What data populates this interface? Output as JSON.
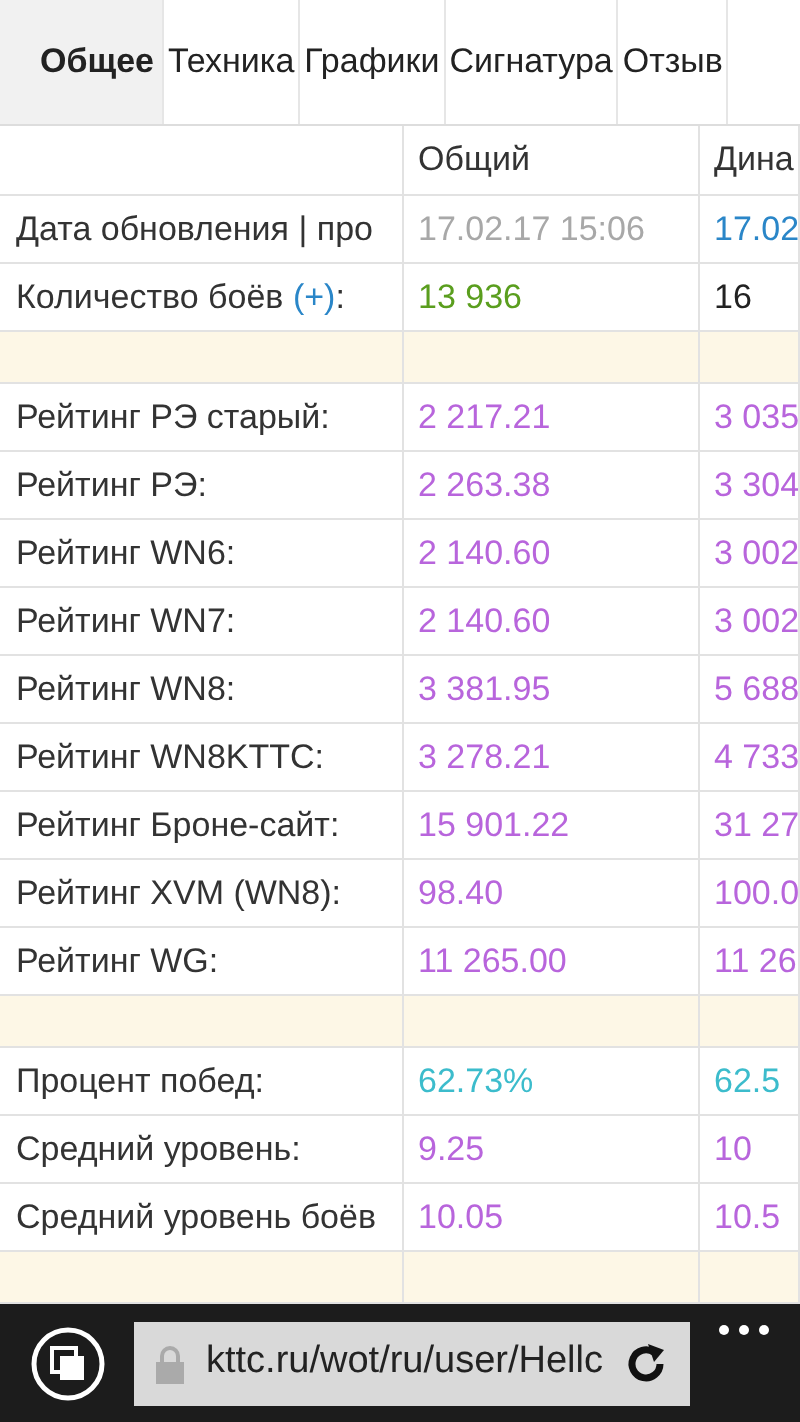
{
  "tabs": [
    {
      "label": "Общее",
      "selected": true
    },
    {
      "label": "Техника",
      "selected": false
    },
    {
      "label": "Графики",
      "selected": false
    },
    {
      "label": "Сигнатура",
      "selected": false
    },
    {
      "label": "Отзыв",
      "selected": false
    }
  ],
  "table": {
    "columns": [
      "Общий",
      "Дина"
    ],
    "rows": [
      {
        "kind": "data",
        "label": "Дата обновления | про",
        "values": [
          {
            "text": "17.02.17 15:06",
            "color": "#a8a8a8"
          },
          {
            "text": "17.02",
            "color": "#2a86c8"
          }
        ]
      },
      {
        "kind": "data",
        "label": "Количество боёв",
        "link": "(+)",
        "label_end": ":",
        "values": [
          {
            "text": "13 936",
            "color": "#5a9e1e"
          },
          {
            "text": "16",
            "color": "#222222"
          }
        ]
      },
      {
        "kind": "spacer"
      },
      {
        "kind": "data",
        "label": "Рейтинг РЭ старый:",
        "values": [
          {
            "text": "2 217.21",
            "color": "#b865dc"
          },
          {
            "text": "3 035",
            "color": "#b865dc"
          }
        ]
      },
      {
        "kind": "data",
        "label": "Рейтинг РЭ:",
        "values": [
          {
            "text": "2 263.38",
            "color": "#b865dc"
          },
          {
            "text": "3 304",
            "color": "#b865dc"
          }
        ]
      },
      {
        "kind": "data",
        "label": "Рейтинг WN6:",
        "values": [
          {
            "text": "2 140.60",
            "color": "#b865dc"
          },
          {
            "text": "3 002",
            "color": "#b865dc"
          }
        ]
      },
      {
        "kind": "data",
        "label": "Рейтинг WN7:",
        "values": [
          {
            "text": "2 140.60",
            "color": "#b865dc"
          },
          {
            "text": "3 002",
            "color": "#b865dc"
          }
        ]
      },
      {
        "kind": "data",
        "label": "Рейтинг WN8:",
        "values": [
          {
            "text": "3 381.95",
            "color": "#b865dc"
          },
          {
            "text": "5 688",
            "color": "#b865dc"
          }
        ]
      },
      {
        "kind": "data",
        "label": "Рейтинг WN8KTTC:",
        "values": [
          {
            "text": "3 278.21",
            "color": "#b865dc"
          },
          {
            "text": "4 733",
            "color": "#b865dc"
          }
        ]
      },
      {
        "kind": "data",
        "label": "Рейтинг Броне-сайт:",
        "values": [
          {
            "text": "15 901.22",
            "color": "#b865dc"
          },
          {
            "text": "31 27",
            "color": "#b865dc"
          }
        ]
      },
      {
        "kind": "data",
        "label": "Рейтинг XVM (WN8):",
        "values": [
          {
            "text": "98.40",
            "color": "#b865dc"
          },
          {
            "text": "100.0",
            "color": "#b865dc"
          }
        ]
      },
      {
        "kind": "data",
        "label": "Рейтинг WG:",
        "values": [
          {
            "text": "11 265.00",
            "color": "#b865dc"
          },
          {
            "text": "11 26",
            "color": "#b865dc"
          }
        ]
      },
      {
        "kind": "spacer"
      },
      {
        "kind": "data",
        "label": "Процент побед:",
        "values": [
          {
            "text": "62.73%",
            "color": "#3cbccc"
          },
          {
            "text": "62.5",
            "color": "#3cbccc"
          }
        ]
      },
      {
        "kind": "data",
        "label": "Средний уровень:",
        "values": [
          {
            "text": "9.25",
            "color": "#b865dc"
          },
          {
            "text": "10",
            "color": "#b865dc"
          }
        ]
      },
      {
        "kind": "data",
        "label": "Средний уровень боёв",
        "values": [
          {
            "text": "10.05",
            "color": "#b865dc"
          },
          {
            "text": "10.5",
            "color": "#b865dc"
          }
        ]
      },
      {
        "kind": "spacer"
      }
    ]
  },
  "address_bar": {
    "url": "kttc.ru/wot/ru/user/Hellc"
  }
}
